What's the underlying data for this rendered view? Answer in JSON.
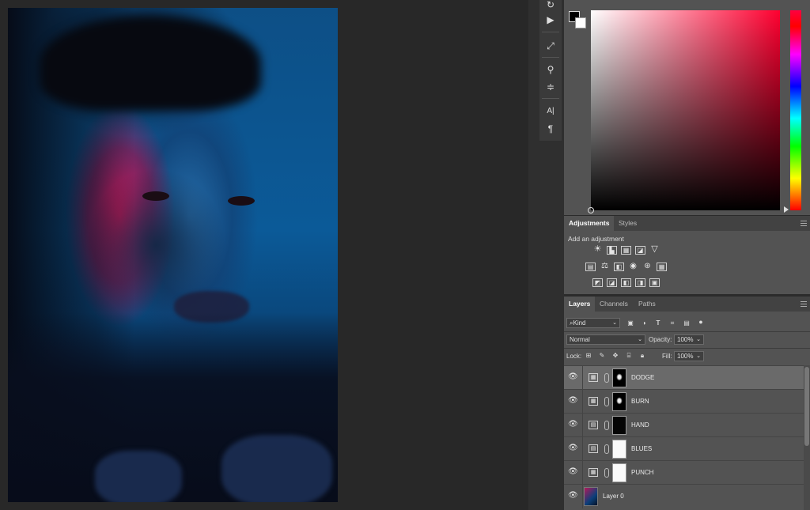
{
  "canvas": {
    "image_alt": "portrait photo lit in red and blue"
  },
  "tools": [
    {
      "icon": "history-brush-icon",
      "glyph": "↻"
    },
    {
      "icon": "play-icon",
      "glyph": "▶"
    },
    {
      "icon": "brush-presets-icon",
      "glyph": "⤢"
    },
    {
      "icon": "clone-source-icon",
      "glyph": "⚲"
    },
    {
      "icon": "properties-icon",
      "glyph": "≑"
    },
    {
      "icon": "character-icon",
      "glyph": "A|"
    },
    {
      "icon": "paragraph-icon",
      "glyph": "¶"
    }
  ],
  "color": {
    "foreground": "#000000",
    "background": "#ffffff",
    "hue_color": "#ff0030"
  },
  "adjustments": {
    "tabs": [
      "Adjustments",
      "Styles"
    ],
    "title": "Add an adjustment",
    "row1": [
      "☀",
      "▙",
      "▦",
      "◪",
      "▽"
    ],
    "row2": [
      "▤",
      "⚖",
      "◧",
      "◉",
      "⊛",
      "▦"
    ],
    "row3": [
      "◩",
      "◪",
      "◧",
      "◨",
      "▣"
    ]
  },
  "layers": {
    "tabs": [
      "Layers",
      "Channels",
      "Paths"
    ],
    "filter_kind": "Kind",
    "blend_mode": "Normal",
    "opacity_label": "Opacity:",
    "opacity_value": "100%",
    "lock_label": "Lock:",
    "fill_label": "Fill:",
    "fill_value": "100%",
    "items": [
      {
        "name": "DODGE",
        "type": "curves",
        "mask": "sil",
        "selected": true
      },
      {
        "name": "BURN",
        "type": "curves",
        "mask": "sil",
        "selected": false
      },
      {
        "name": "HAND",
        "type": "channel-mixer",
        "mask": "black",
        "selected": false
      },
      {
        "name": "BLUES",
        "type": "channel-mixer",
        "mask": "white",
        "selected": false
      },
      {
        "name": "PUNCH",
        "type": "curves",
        "mask": "white",
        "selected": false
      },
      {
        "name": "Layer 0",
        "type": "pixel",
        "mask": "",
        "selected": false
      }
    ]
  }
}
